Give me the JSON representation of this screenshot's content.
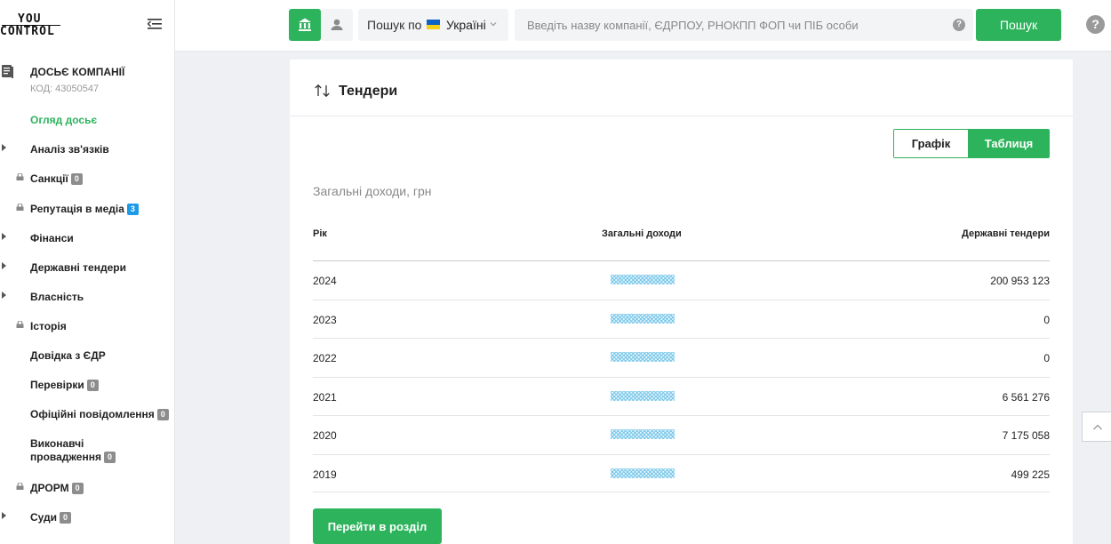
{
  "sidebar": {
    "logo": {
      "line1": "YOU",
      "line2": "CONTROL"
    },
    "dossier": {
      "title": "ДОСЬЄ КОМПАНІЇ",
      "code": "КОД: 43050547"
    },
    "items": [
      {
        "label": "Огляд досьє",
        "active": true
      },
      {
        "label": "Аналіз зв'язків",
        "arrow": true
      },
      {
        "label": "Санкції",
        "lock": true,
        "badge": "0"
      },
      {
        "label": "Репутація в медіа",
        "lock": true,
        "badge": "3"
      },
      {
        "label": "Фінанси",
        "arrow": true
      },
      {
        "label": "Державні тендери",
        "arrow": true
      },
      {
        "label": "Власність",
        "arrow": true
      },
      {
        "label": "Історія",
        "lock": true
      },
      {
        "label": "Довідка з ЄДР"
      },
      {
        "label": "Перевірки",
        "badge": "0"
      },
      {
        "label": "Офіційні повідомлення",
        "badge": "0"
      },
      {
        "label_line1": "Виконавчі",
        "label_line2": "провадження",
        "badge": "0"
      },
      {
        "label": "ДРОРМ",
        "lock": true,
        "badge": "0"
      },
      {
        "label": "Суди",
        "arrow": true,
        "badge": "0"
      }
    ]
  },
  "topbar": {
    "search_by": "Пошук по",
    "country": "Україні",
    "search_placeholder": "Введіть назву компанії, ЄДРПОУ, РНОКПП ФОП чи ПІБ особи",
    "help_small": "?",
    "search_button": "Пошук",
    "help_big": "?"
  },
  "tenders": {
    "title": "Тендери",
    "toggle": {
      "graph": "Графік",
      "table": "Таблиця",
      "selected": "Таблиця"
    },
    "subtitle": "Загальні доходи, грн",
    "columns": [
      "Рік",
      "Загальні доходи",
      "Державні тендери"
    ],
    "rows": [
      {
        "year": "2024",
        "tenders": "200 953 123"
      },
      {
        "year": "2023",
        "tenders": "0"
      },
      {
        "year": "2022",
        "tenders": "0"
      },
      {
        "year": "2021",
        "tenders": "6 561 276"
      },
      {
        "year": "2020",
        "tenders": "7 175 058"
      },
      {
        "year": "2019",
        "tenders": "499 225"
      }
    ],
    "goto_button": "Перейти в розділ"
  },
  "colors": {
    "accent": "#2db35c",
    "badge_blue": "#1e9be8",
    "badge_grey": "#8d8d8d"
  }
}
